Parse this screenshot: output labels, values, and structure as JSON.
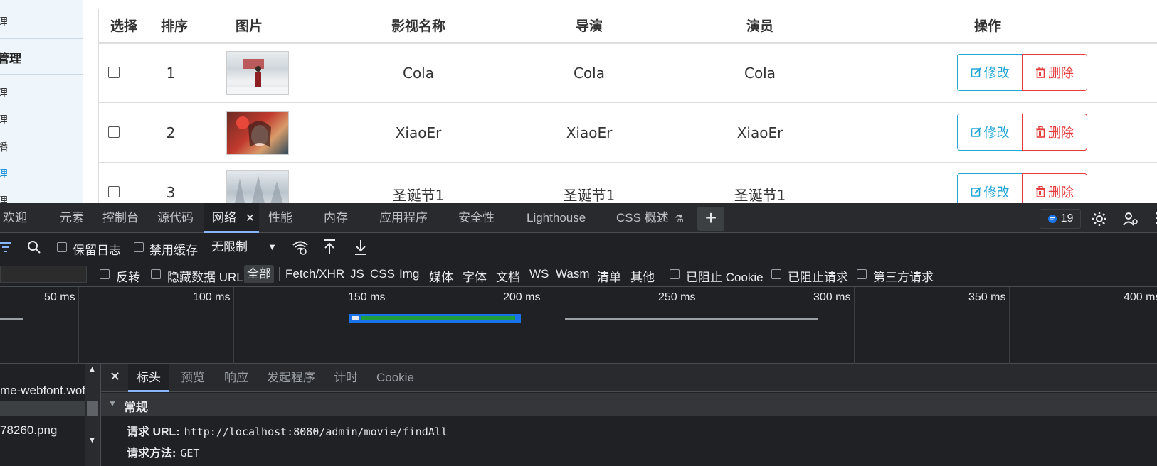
{
  "sidebar": {
    "items": [
      {
        "label": "理",
        "head": false,
        "active": false
      },
      {
        "label": "管理",
        "head": true,
        "active": false
      },
      {
        "label": "理",
        "head": false,
        "active": false
      },
      {
        "label": "理",
        "head": false,
        "active": false
      },
      {
        "label": "播",
        "head": false,
        "active": false
      },
      {
        "label": "理",
        "head": false,
        "active": true
      },
      {
        "label": "理",
        "head": false,
        "active": false
      }
    ]
  },
  "table": {
    "headers": [
      "选择",
      "排序",
      "图片",
      "影视名称",
      "导演",
      "演员",
      "操作"
    ],
    "rows": [
      {
        "order": "1",
        "name": "Cola",
        "director": "Cola",
        "actor": "Cola"
      },
      {
        "order": "2",
        "name": "XiaoEr",
        "director": "XiaoEr",
        "actor": "XiaoEr"
      },
      {
        "order": "3",
        "name": "圣诞节1",
        "director": "圣诞节1",
        "actor": "圣诞节1"
      }
    ],
    "edit_label": "修改",
    "delete_label": "删除"
  },
  "devtools": {
    "tabs": [
      {
        "label": "欢迎"
      },
      {
        "label": "元素"
      },
      {
        "label": "控制台"
      },
      {
        "label": "源代码"
      },
      {
        "label": "网络"
      },
      {
        "label": "性能"
      },
      {
        "label": "内存"
      },
      {
        "label": "应用程序"
      },
      {
        "label": "安全性"
      },
      {
        "label": "Lighthouse"
      },
      {
        "label": "CSS 概述"
      }
    ],
    "issues_count": "19",
    "toolbar": {
      "preserve_log": "保留日志",
      "disable_cache": "禁用缓存",
      "throttle": "无限制"
    },
    "filters": {
      "invert": "反转",
      "hide_data_urls": "隐藏数据 URL",
      "types": [
        "全部",
        "Fetch/XHR",
        "JS",
        "CSS",
        "Img",
        "媒体",
        "字体",
        "文档",
        "WS",
        "Wasm",
        "清单",
        "其他"
      ],
      "blocked_cookies": "已阻止 Cookie",
      "blocked_requests": "已阻止请求",
      "third_party": "第三方请求"
    },
    "overview_ticks": [
      "50 ms",
      "100 ms",
      "150 ms",
      "200 ms",
      "250 ms",
      "300 ms",
      "350 ms",
      "400 ms"
    ],
    "requests": [
      "me-webfont.wof",
      "78260.png"
    ],
    "detail_tabs": [
      "标头",
      "预览",
      "响应",
      "发起程序",
      "计时",
      "Cookie"
    ],
    "general": {
      "title": "常规",
      "request_url_label": "请求 URL:",
      "request_url": "http://localhost:8080/admin/movie/findAll",
      "request_method_label": "请求方法:",
      "request_method": "GET"
    }
  },
  "colors": {
    "accent_blue": "#23a6d5",
    "danger_red": "#e43b3b",
    "devtools_bg": "#202124",
    "tab_underline": "#8ab4f8"
  }
}
